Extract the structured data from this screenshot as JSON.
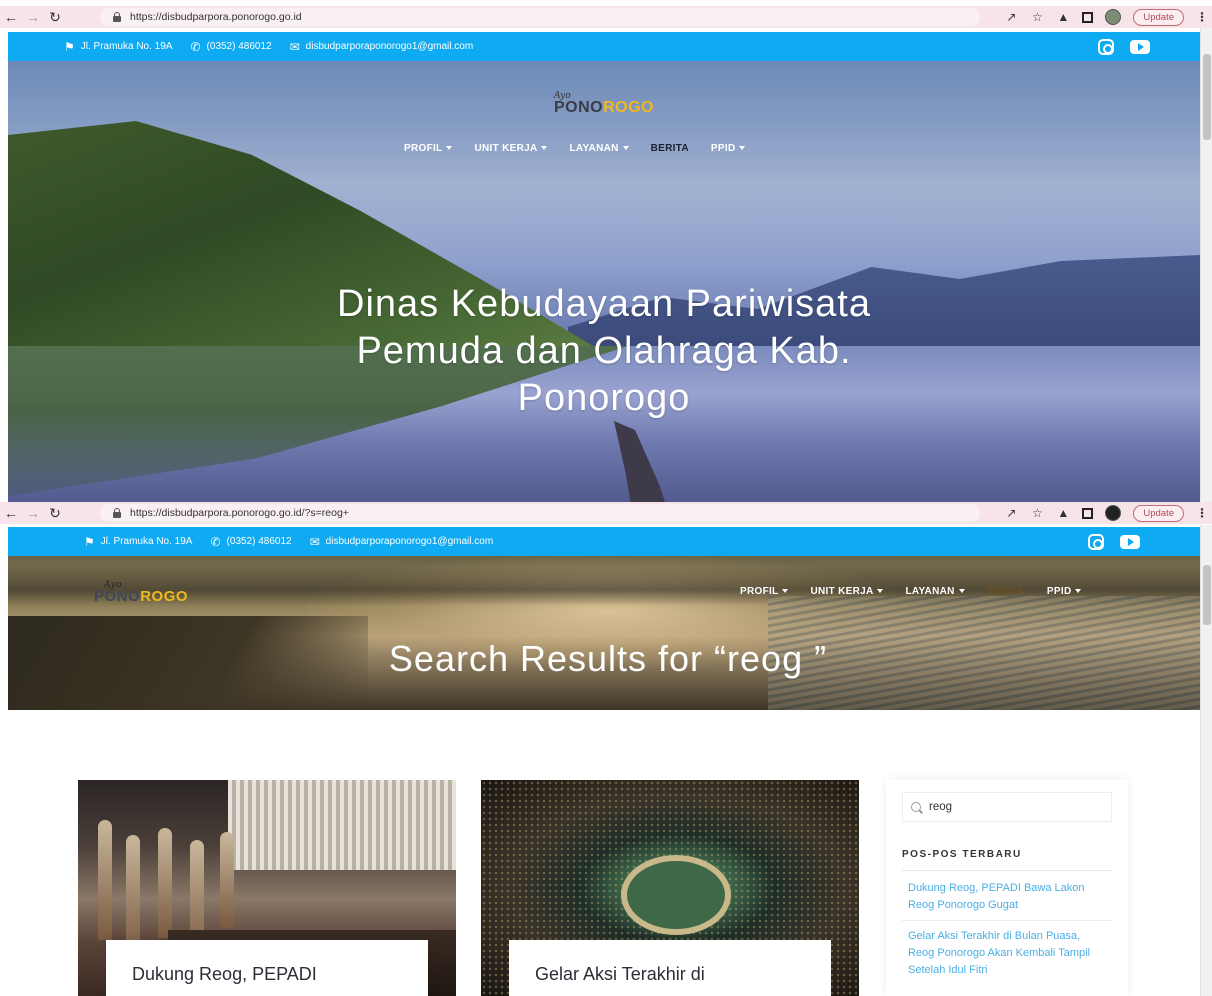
{
  "colors": {
    "accent": "#0eaaf2",
    "link": "#4aaee6",
    "logo_yellow": "#f0b820",
    "chrome_bg": "#f6e4e8"
  },
  "browser_top": {
    "url": "https://disbudparpora.ponorogo.go.id",
    "update_label": "Update"
  },
  "browser_bottom": {
    "url": "https://disbudparpora.ponorogo.go.id/?s=reog+",
    "update_label": "Update"
  },
  "topbar": {
    "address": "Jl. Pramuka No. 19A",
    "phone": "(0352) 486012",
    "email": "disbudparporaponorogo1@gmail.com"
  },
  "logo": {
    "script": "Ayo",
    "part1": "PONO",
    "part2": "ROGO"
  },
  "nav": {
    "profil": "PROFIL",
    "unit_kerja": "UNIT KERJA",
    "layanan": "LAYANAN",
    "berita": "BERITA",
    "ppid": "PPID"
  },
  "hero_home": {
    "title_line1": "Dinas Kebudayaan Pariwisata",
    "title_line2": "Pemuda dan Olahraga Kab.",
    "title_line3": "Ponorogo"
  },
  "hero_search": {
    "title": "Search Results for “reog ”"
  },
  "posts": [
    {
      "title": "Dukung Reog, PEPADI"
    },
    {
      "title": "Gelar Aksi Terakhir di"
    }
  ],
  "sidebar": {
    "search_value": "reog",
    "recent_heading": "POS-POS TERBARU",
    "recent_posts": [
      "Dukung Reog, PEPADI Bawa Lakon Reog Ponorogo Gugat",
      "Gelar Aksi Terakhir di Bulan Puasa, Reog Ponorogo Akan Kembali Tampil Setelah Idul Fitri"
    ]
  }
}
